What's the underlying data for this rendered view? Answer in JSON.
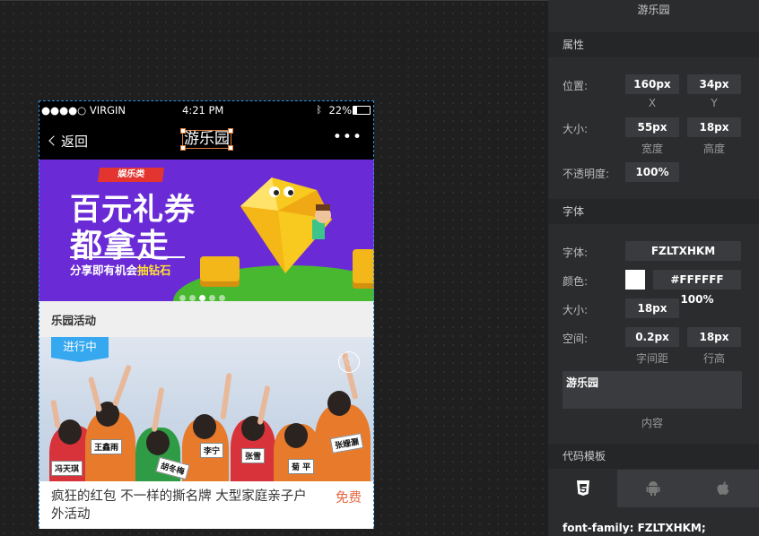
{
  "canvas_title": "游乐园",
  "phone": {
    "status": {
      "carrier": "●●●●○ VIRGIN",
      "time": "4:21 PM",
      "battery": "22%"
    },
    "nav": {
      "back_label": "返回",
      "title": "游乐园",
      "more": "•••"
    },
    "selection_badge": "12px",
    "banner": {
      "ribbon": "娱乐类",
      "line1": "百元礼券",
      "line2": "都拿走",
      "subtitle_prefix": "分享即有机会",
      "subtitle_highlight": "抽钻石"
    },
    "section_title": "乐园活动",
    "card": {
      "tag": "进行中",
      "caption": "疯狂的红包 不一样的撕名牌 大型家庭亲子户外活动",
      "price": "免费",
      "name_tags": [
        "冯天琪",
        "王鑫雨",
        "胡冬梅",
        "李宁",
        "张雪",
        "菊 平",
        "张姗灏"
      ]
    }
  },
  "panel": {
    "title": "游乐园",
    "attributes": {
      "section": "属性",
      "position_label": "位置:",
      "x_value": "160px",
      "y_value": "34px",
      "x_caption": "X",
      "y_caption": "Y",
      "size_label": "大小:",
      "width_value": "55px",
      "height_value": "18px",
      "width_caption": "宽度",
      "height_caption": "高度",
      "opacity_label": "不透明度:",
      "opacity_value": "100%"
    },
    "font": {
      "section": "字体",
      "family_label": "字体:",
      "family_value": "FZLTXHKM",
      "color_label": "颜色:",
      "color_value": "#FFFFFF 100%",
      "color_hex": "#FFFFFF",
      "size_label": "大小:",
      "size_value": "18px",
      "spacing_label": "空间:",
      "letter_spacing_value": "0.2px",
      "line_height_value": "18px",
      "letter_spacing_caption": "字间距",
      "line_height_caption": "行高",
      "content_value": "游乐园",
      "content_caption": "内容"
    },
    "code": {
      "section": "代码模板",
      "tabs": [
        "css3-icon",
        "android-icon",
        "apple-icon"
      ],
      "line": "font-family: FZLTXHKM;"
    }
  }
}
